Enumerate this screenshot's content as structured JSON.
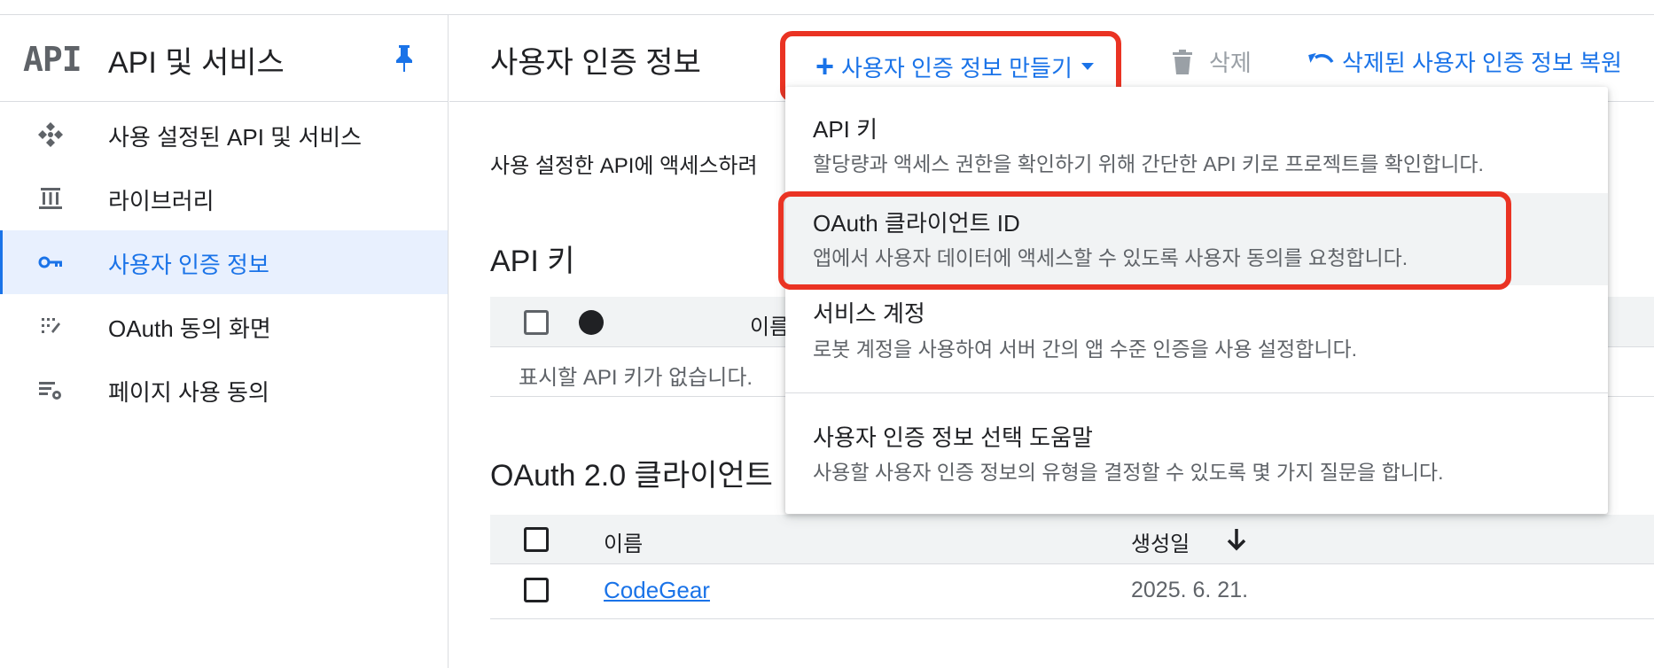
{
  "sidebar": {
    "logo": "API",
    "title": "API 및 서비스",
    "items": [
      {
        "label": "사용 설정된 API 및 서비스",
        "icon": "enabled-apis-icon"
      },
      {
        "label": "라이브러리",
        "icon": "library-icon"
      },
      {
        "label": "사용자 인증 정보",
        "icon": "key-icon",
        "active": true
      },
      {
        "label": "OAuth 동의 화면",
        "icon": "consent-icon"
      },
      {
        "label": "페이지 사용 동의",
        "icon": "settings-list-icon"
      }
    ]
  },
  "header": {
    "title": "사용자 인증 정보",
    "create_label": "사용자 인증 정보 만들기",
    "delete_label": "삭제",
    "restore_label": "삭제된 사용자 인증 정보 복원"
  },
  "main": {
    "description": "사용 설정한 API에 액세스하려",
    "api_keys": {
      "title": "API 키",
      "col_name": "이름",
      "empty": "표시할 API 키가 없습니다."
    },
    "oauth": {
      "title": "OAuth 2.0 클라이언트",
      "col_name": "이름",
      "col_created": "생성일",
      "rows": [
        {
          "name": "CodeGear",
          "created": "2025. 6. 21."
        }
      ]
    }
  },
  "menu": {
    "items": [
      {
        "title": "API 키",
        "desc": "할당량과 액세스 권한을 확인하기 위해 간단한 API 키로 프로젝트를 확인합니다."
      },
      {
        "title": "OAuth 클라이언트 ID",
        "desc": "앱에서 사용자 데이터에 액세스할 수 있도록 사용자 동의를 요청합니다.",
        "highlighted": true
      },
      {
        "title": "서비스 계정",
        "desc": "로봇 계정을 사용하여 서버 간의 앱 수준 인증을 사용 설정합니다."
      },
      {
        "title": "사용자 인증 정보 선택 도움말",
        "desc": "사용할 사용자 인증 정보의 유형을 결정할 수 있도록 몇 가지 질문을 합니다."
      }
    ]
  },
  "colors": {
    "accent": "#1a73e8",
    "highlight": "#ea3323",
    "active_bg": "#e8f0fe"
  }
}
